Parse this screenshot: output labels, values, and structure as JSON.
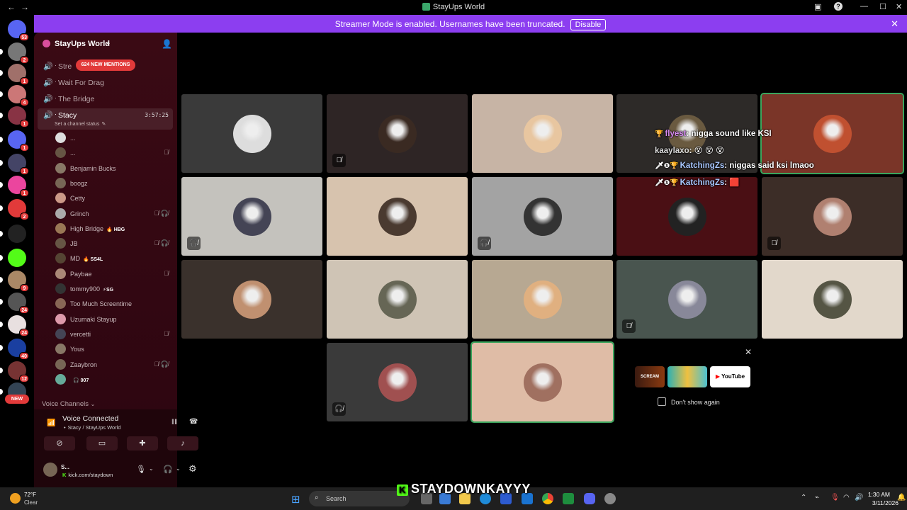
{
  "window": {
    "title": "StayUps World",
    "nav_back": "←",
    "nav_fwd": "→"
  },
  "banner": {
    "message": "Streamer Mode is enabled. Usernames have been truncated.",
    "disable_label": "Disable"
  },
  "servers": [
    {
      "badge": "53",
      "color": "#5865f2"
    },
    {
      "badge": "2",
      "color": "#777"
    },
    {
      "badge": "1",
      "color": "#a0706a"
    },
    {
      "badge": "4",
      "color": "#c77"
    },
    {
      "badge": "1",
      "color": "#834"
    },
    {
      "badge": "1",
      "color": "#5865f2"
    },
    {
      "badge": "1",
      "color": "#446"
    },
    {
      "badge": "1",
      "color": "#eb459e"
    },
    {
      "badge": "2",
      "color": "#e23a3a"
    },
    {
      "badge": "",
      "color": "#222"
    },
    {
      "badge": "",
      "color": "#53fc18"
    },
    {
      "badge": "9",
      "color": "#a86"
    },
    {
      "badge": "24",
      "color": "#555"
    },
    {
      "badge": "24",
      "color": "#e8e0e0"
    },
    {
      "badge": "40",
      "color": "#1a3fa0"
    },
    {
      "badge": "12",
      "color": "#733"
    },
    {
      "badge": "",
      "color": "#345"
    }
  ],
  "new_label": "NEW",
  "sidebar": {
    "guild_name": "StayUps World",
    "mentions_label": "624 NEW MENTIONS",
    "channels": [
      {
        "name": "Stre"
      },
      {
        "name": "Wait For Drag"
      },
      {
        "name": "The Bridge"
      },
      {
        "name": "Stacy",
        "timer": "3:57:25",
        "status": "Set a channel status"
      }
    ],
    "members": [
      {
        "name": "...",
        "tag": "",
        "icons": "",
        "color": "#ddd"
      },
      {
        "name": "...",
        "tag": "",
        "icons": "🎙̸",
        "color": "#654"
      },
      {
        "name": "Benjamin Bucks",
        "tag": "",
        "icons": "",
        "color": "#876"
      },
      {
        "name": "boogz",
        "tag": "",
        "icons": "",
        "color": "#765"
      },
      {
        "name": "Cetty",
        "tag": "",
        "icons": "",
        "color": "#c98"
      },
      {
        "name": "Grinch",
        "tag": "",
        "icons": "🎙̸ 🎧̸",
        "color": "#aaa"
      },
      {
        "name": "High Bridge",
        "tag": "🔥 HBG",
        "icons": "",
        "color": "#975"
      },
      {
        "name": "JB",
        "tag": "",
        "icons": "🎙̸ 🎧̸",
        "color": "#654"
      },
      {
        "name": "MD",
        "tag": "🔥 SS4L",
        "icons": "",
        "color": "#543"
      },
      {
        "name": "Paybae",
        "tag": "",
        "icons": "🎙̸",
        "color": "#a87"
      },
      {
        "name": "tommy900",
        "tag": "⚡SG",
        "icons": "",
        "color": "#333"
      },
      {
        "name": "Too Much Screentime",
        "tag": "",
        "icons": "",
        "color": "#865"
      },
      {
        "name": "Uzumaki Stayup",
        "tag": "",
        "icons": "",
        "color": "#d9a"
      },
      {
        "name": "vercetti",
        "tag": "",
        "icons": "🎙̸",
        "color": "#445"
      },
      {
        "name": "Yous",
        "tag": "",
        "icons": "",
        "color": "#876"
      },
      {
        "name": "Zaaybron",
        "tag": "",
        "icons": "🎙̸ 🎧̸",
        "color": "#765"
      },
      {
        "name": "",
        "tag": "🎧 007",
        "icons": "",
        "color": "#6a9"
      }
    ],
    "voice_channels_label": "Voice Channels"
  },
  "voice": {
    "status": "Voice Connected",
    "location": "Stacy / StayUps World"
  },
  "user": {
    "name": "S...",
    "status": "kick.com/staydown"
  },
  "grid": [
    {
      "bg": "#3a3a3a",
      "av": "#ddd",
      "mic": ""
    },
    {
      "bg": "#2e2525",
      "av": "#3a2a22",
      "mic": "🎙̸"
    },
    {
      "bg": "#c7b4a5",
      "av": "#e8c6a0",
      "mic": ""
    },
    {
      "bg": "#2d2a28",
      "av": "#6a5a40",
      "mic": ""
    },
    {
      "bg": "#7a3528",
      "av": "#c05030",
      "mic": "",
      "speaking": true
    },
    {
      "bg": "#c4c2bd",
      "av": "#445",
      "mic": "🎧̸"
    },
    {
      "bg": "#d7c3ae",
      "av": "#4a3a30",
      "mic": ""
    },
    {
      "bg": "#a3a3a3",
      "av": "#333",
      "mic": "🎧̸"
    },
    {
      "bg": "#4a0f14",
      "av": "#222",
      "mic": ""
    },
    {
      "bg": "#3c2d27",
      "av": "#b08070",
      "mic": "🎙̸"
    },
    {
      "bg": "#3a312c",
      "av": "#c09070",
      "mic": ""
    },
    {
      "bg": "#cfc4b5",
      "av": "#665",
      "mic": ""
    },
    {
      "bg": "#b7a892",
      "av": "#e0b080",
      "mic": ""
    },
    {
      "bg": "#49554f",
      "av": "#889",
      "mic": "🎙̸"
    },
    {
      "bg": "#e2d8cb",
      "av": "#554",
      "mic": ""
    },
    {
      "bg": "#3a3a3a",
      "av": "#a05050",
      "mic": "🎧̸"
    },
    {
      "bg": "#dfbca6",
      "av": "#a07060",
      "mic": "",
      "speaking": true
    }
  ],
  "chat": [
    {
      "user": "flyest",
      "text": "nigga sound like KSI",
      "style": "u1",
      "prefix": "🏆"
    },
    {
      "user": "kaaylaxo",
      "text": "😵 😵 😵",
      "style": "u2",
      "prefix": ""
    },
    {
      "user": "KatchingZs",
      "text": "niggas said ksi lmaoo",
      "style": "u3",
      "prefix": "🗡❶🏆"
    },
    {
      "user": "KatchingZs",
      "text": "🟥",
      "style": "u3",
      "prefix": "🗡❶🏆"
    }
  ],
  "promo": {
    "close": "✕",
    "checkbox_label": "Don't show again",
    "youtube_label": "YouTube",
    "scream_label": "SCREAM"
  },
  "taskbar": {
    "temp": "72°F",
    "weather": "Clear",
    "search_placeholder": "Search",
    "time": "1:30 AM",
    "date": "3/11/2026"
  },
  "streamer_name": "STAYDOWNKAYYY"
}
